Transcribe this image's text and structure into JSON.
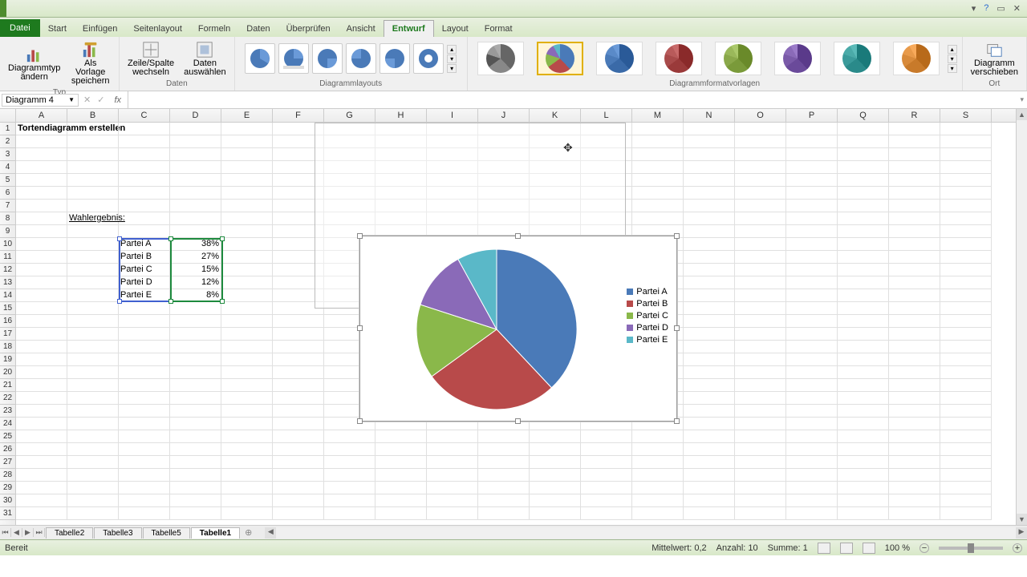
{
  "titlebar_icons": [
    "min",
    "help",
    "restore",
    "close"
  ],
  "tabs": {
    "file": "Datei",
    "items": [
      "Start",
      "Einfügen",
      "Seitenlayout",
      "Formeln",
      "Daten",
      "Überprüfen",
      "Ansicht",
      "Entwurf",
      "Layout",
      "Format"
    ],
    "active": "Entwurf"
  },
  "ribbon": {
    "type_group": {
      "label": "Typ",
      "btn1": "Diagrammtyp\nändern",
      "btn2": "Als Vorlage\nspeichern"
    },
    "data_group": {
      "label": "Daten",
      "btn1": "Zeile/Spalte\nwechseln",
      "btn2": "Daten\nauswählen"
    },
    "layout_group_label": "Diagrammlayouts",
    "style_group_label": "Diagrammformatvorlagen",
    "style_colors": [
      "#666666",
      "#multi",
      "#3a6aa8",
      "#a03a3a",
      "#7ba03a",
      "#6a4a9a",
      "#2a9a9a",
      "#d08a3a"
    ],
    "move_group": {
      "label": "Ort",
      "btn": "Diagramm\nverschieben"
    }
  },
  "name_box": "Diagramm 4",
  "columns": [
    "A",
    "B",
    "C",
    "D",
    "E",
    "F",
    "G",
    "H",
    "I",
    "J",
    "K",
    "L",
    "M",
    "N",
    "O",
    "P",
    "Q",
    "R",
    "S"
  ],
  "rows": 31,
  "cell_data": {
    "title": "Tortendiagramm erstellen",
    "subtitle": "Wahlergebnis:",
    "table": [
      {
        "label": "Partei A",
        "value": "38%"
      },
      {
        "label": "Partei B",
        "value": "27%"
      },
      {
        "label": "Partei C",
        "value": "15%"
      },
      {
        "label": "Partei D",
        "value": "12%"
      },
      {
        "label": "Partei E",
        "value": "8%"
      }
    ]
  },
  "chart_data": {
    "type": "pie",
    "title": "",
    "series": [
      {
        "name": "Partei A",
        "value": 38,
        "color": "#4a7ab8"
      },
      {
        "name": "Partei B",
        "value": 27,
        "color": "#b84a4a"
      },
      {
        "name": "Partei C",
        "value": 15,
        "color": "#8ab84a"
      },
      {
        "name": "Partei D",
        "value": 12,
        "color": "#8a6ab8"
      },
      {
        "name": "Partei E",
        "value": 8,
        "color": "#5ab8c8"
      }
    ]
  },
  "sheets": [
    "Tabelle2",
    "Tabelle3",
    "Tabelle5",
    "Tabelle1"
  ],
  "active_sheet": "Tabelle1",
  "status": {
    "ready": "Bereit",
    "avg": "Mittelwert: 0,2",
    "count": "Anzahl: 10",
    "sum": "Summe: 1",
    "zoom": "100 %"
  }
}
